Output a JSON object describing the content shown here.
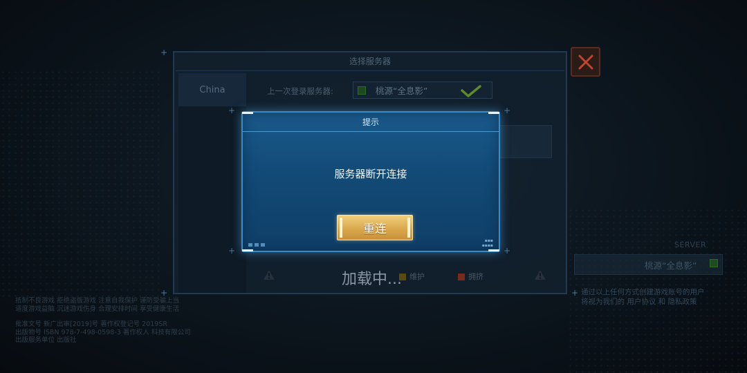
{
  "panel": {
    "title": "选择服务器",
    "region_tab": "China",
    "last_server_label": "上一次登录服务器:",
    "last_server_name": "桃源“全息影”"
  },
  "dialog": {
    "title": "提示",
    "message": "服务器断开连接",
    "retry_label": "重连"
  },
  "loading_text": "加载中...",
  "status_legend": [
    "维护",
    "拥挤"
  ],
  "right_panel": {
    "server_tag": "SERVER",
    "server_name": "桃源“全息影”",
    "notice_line1": "通过以上任何方式创建游戏账号的用户",
    "notice_line2": "将视为我们的 用户协议 和 隐私政策"
  },
  "colors": {
    "dialog_bg": "#124a76",
    "dialog_border": "#3c8cc4",
    "retry_button": "#dba84d",
    "close_button_x": "#c0442e",
    "status_ok": "#2d6a2d",
    "status_busy": "#7a2a1a",
    "status_maint": "#7a6a1a"
  },
  "icons": [
    "close-icon",
    "check-icon",
    "warning-icon"
  ]
}
